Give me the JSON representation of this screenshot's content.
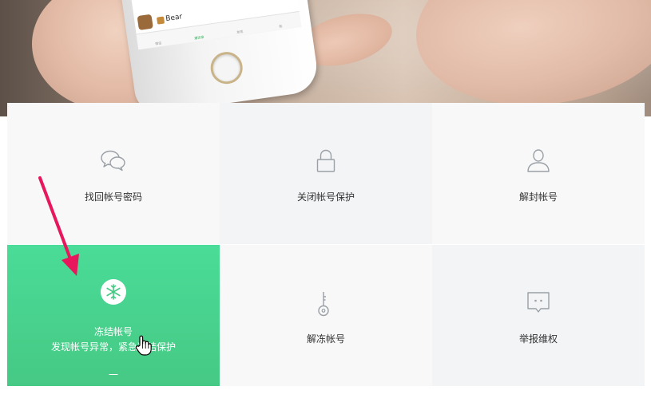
{
  "phone": {
    "contact_name": "Bear",
    "tabs": [
      "微信",
      "通讯录",
      "发现",
      "我"
    ]
  },
  "tiles": [
    {
      "label": "找回帐号密码",
      "icon": "chat-bubbles-icon"
    },
    {
      "label": "关闭帐号保护",
      "icon": "lock-icon"
    },
    {
      "label": "解封帐号",
      "icon": "person-icon"
    },
    {
      "label": "冻结帐号",
      "sublabel": "发现帐号异常，紧急冻结保护",
      "icon": "snowflake-icon"
    },
    {
      "label": "解冻帐号",
      "icon": "key-icon"
    },
    {
      "label": "举报维权",
      "icon": "report-bubble-icon"
    }
  ],
  "colors": {
    "accent": "#4ccf8d",
    "annotation": "#e8175d",
    "icon_gray": "#9aa0a6"
  }
}
